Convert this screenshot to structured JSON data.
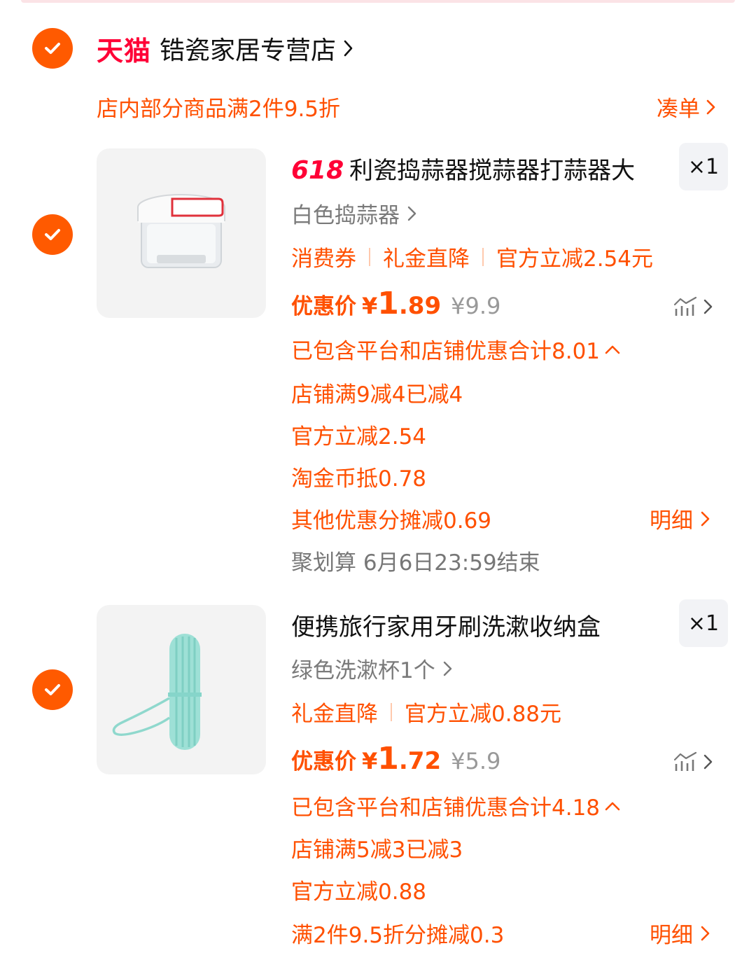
{
  "store": {
    "platform": "天猫",
    "name": "锆瓷家居专营店",
    "promo": "店内部分商品满2件9.5折",
    "promo_action": "凑单"
  },
  "items": [
    {
      "tag": "618",
      "title": "利瓷捣蒜器搅蒜器打蒜器大",
      "qty": "×1",
      "spec": "白色捣蒜器",
      "tags": [
        "消费券",
        "礼金直降",
        "官方立减2.54元"
      ],
      "price_label": "优惠价",
      "price_yen": "¥",
      "price_int": "1",
      "price_dec": ".89",
      "original_price": "¥9.9",
      "discount_summary": "已包含平台和店铺优惠合计8.01",
      "discounts": [
        "店铺满9减4已减4",
        "官方立减2.54",
        "淘金币抵0.78",
        "其他优惠分摊减0.69"
      ],
      "detail_label": "明细",
      "event_note": "聚划算 6月6日23:59结束"
    },
    {
      "title": "便携旅行家用牙刷洗漱收纳盒",
      "qty": "×1",
      "spec": "绿色洗漱杯1个",
      "tags": [
        "礼金直降",
        "官方立减0.88元"
      ],
      "price_label": "优惠价",
      "price_yen": "¥",
      "price_int": "1",
      "price_dec": ".72",
      "original_price": "¥5.9",
      "discount_summary": "已包含平台和店铺优惠合计4.18",
      "discounts": [
        "店铺满5减3已减3",
        "官方立减0.88",
        "满2件9.5折分摊减0.3"
      ],
      "detail_label": "明细"
    }
  ],
  "colors": {
    "accent": "#ff5000",
    "check": "#ff5a00",
    "tmall": "#ff0036"
  }
}
